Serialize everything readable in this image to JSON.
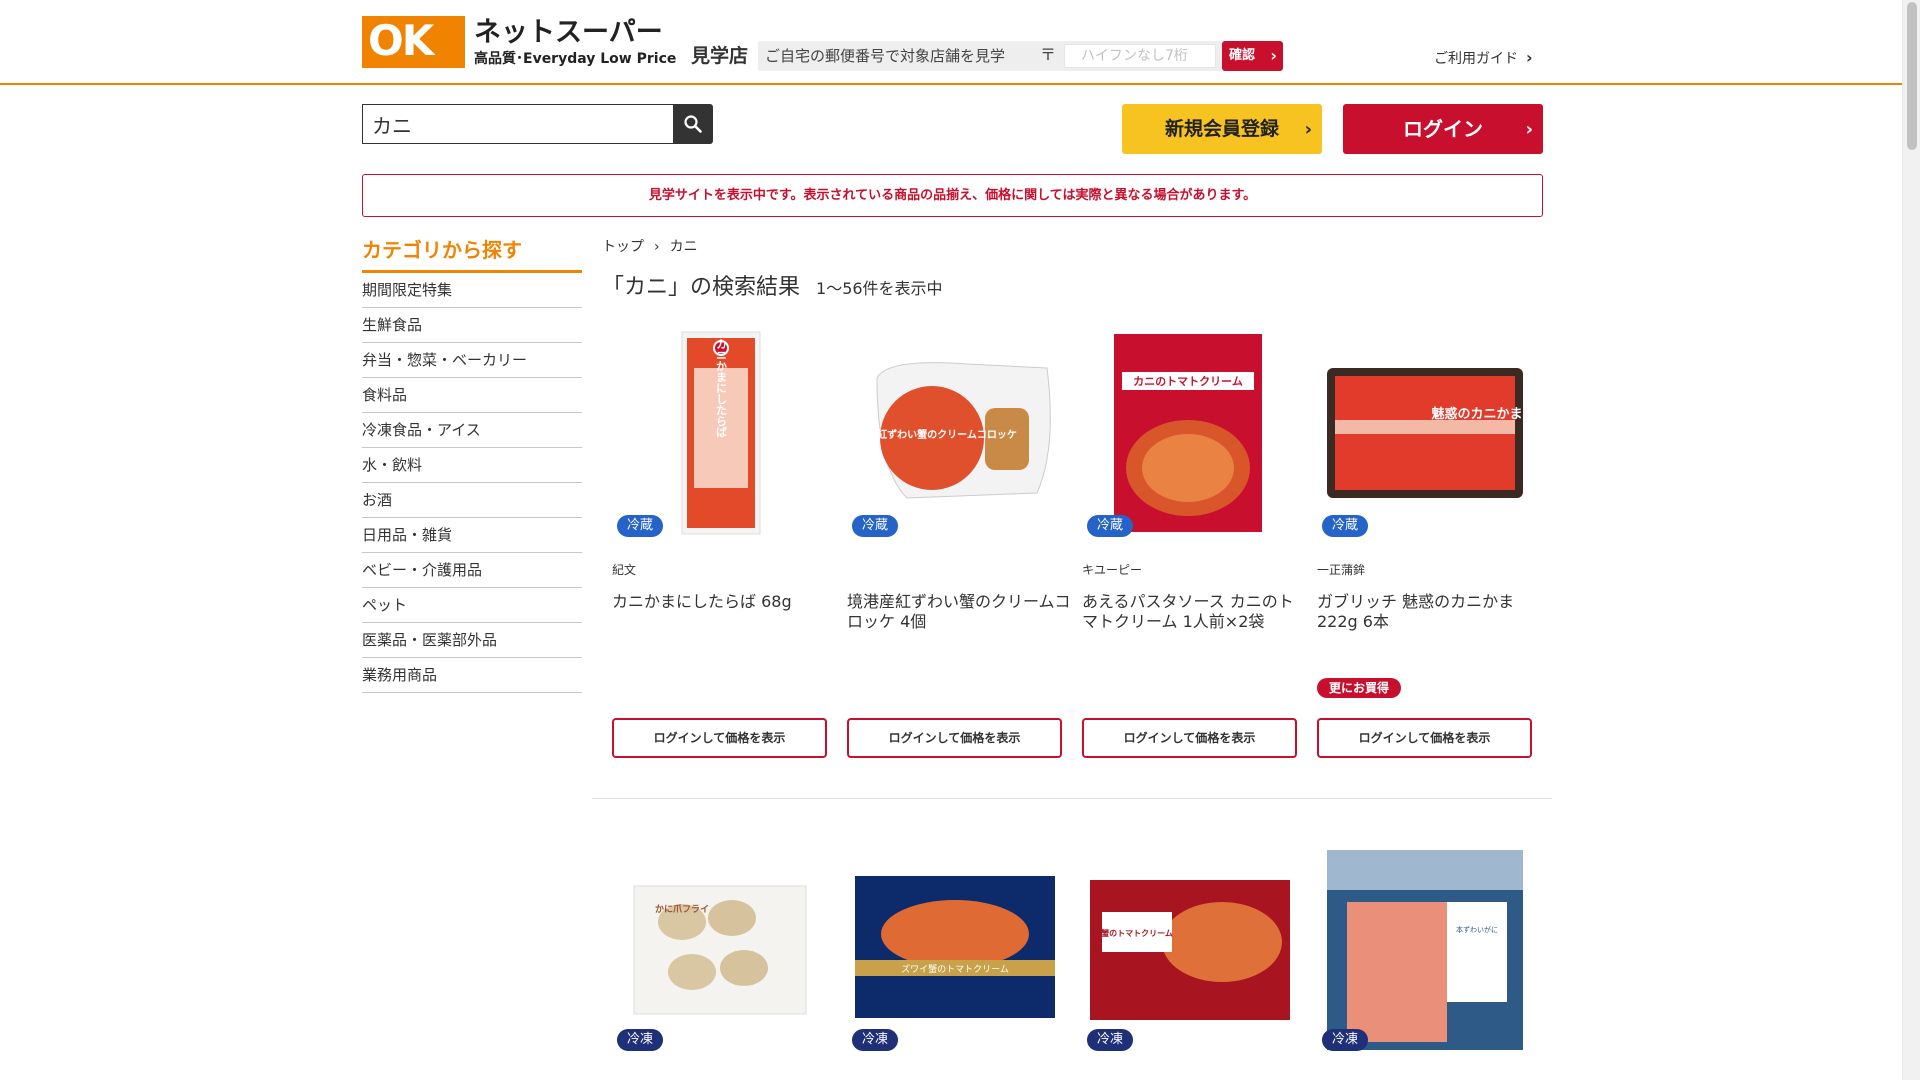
{
  "header": {
    "logo_mark": "OK",
    "logo_name": "ネットスーパー",
    "logo_tagline": "高品質･Everyday Low Price",
    "store_label": "見学店",
    "postal_prompt": "ご自宅の郵便番号で対象店舗を見学",
    "postal_mark": "〒",
    "postal_placeholder": "ハイフンなし7桁",
    "confirm_label": "確認",
    "guide_label": "ご利用ガイド"
  },
  "search": {
    "value": "カニ"
  },
  "auth": {
    "register_label": "新規会員登録",
    "login_label": "ログイン"
  },
  "notice": "見学サイトを表示中です。表示されている商品の品揃え、価格に関しては実際と異なる場合があります。",
  "sidebar": {
    "title": "カテゴリから探す",
    "items": [
      "期間限定特集",
      "生鮮食品",
      "弁当・惣菜・ベーカリー",
      "食料品",
      "冷凍食品・アイス",
      "水・飲料",
      "お酒",
      "日用品・雑貨",
      "ベビー・介護用品",
      "ペット",
      "医薬品・医薬部外品",
      "業務用商品"
    ]
  },
  "breadcrumb": {
    "home": "トップ",
    "sep": "›",
    "current": "カニ"
  },
  "results": {
    "title": "「カニ」の検索結果",
    "count": "1～56件を表示中"
  },
  "price_button_label": "ログインして価格を表示",
  "products": [
    {
      "badge": "冷蔵",
      "brand": "紀文",
      "name": "カニかまにしたらば 68g",
      "deal": "",
      "img_text": "カニかまにしたらば"
    },
    {
      "badge": "冷蔵",
      "brand": "",
      "name": "境港産紅ずわい蟹のクリームコロッケ 4個",
      "deal": "",
      "img_text": "境港産紅ずわい蟹のクリームコロッケ"
    },
    {
      "badge": "冷蔵",
      "brand": "キユーピー",
      "name": "あえるパスタソース カニのトマトクリーム 1人前×2袋",
      "deal": "",
      "img_text": "カニのトマトクリーム"
    },
    {
      "badge": "冷蔵",
      "brand": "一正蒲鉾",
      "name": "ガブリッチ 魅惑のカニかま 222g 6本",
      "deal": "更にお買得",
      "img_text": "魅惑のカニかま"
    },
    {
      "badge": "冷凍",
      "img_text": "かに爪フライ"
    },
    {
      "badge": "冷凍",
      "img_text": "ズワイ蟹のトマトクリーム"
    },
    {
      "badge": "冷凍",
      "img_text": "蟹のトマトクリーム"
    },
    {
      "badge": "冷凍",
      "img_text": "本ずわいがに"
    }
  ],
  "colors": {
    "accent_orange": "#f08300",
    "brand_red": "#c8102e",
    "register_yellow": "#f7c321",
    "chilled_badge": "#2563c9",
    "frozen_badge": "#1f2f78"
  }
}
